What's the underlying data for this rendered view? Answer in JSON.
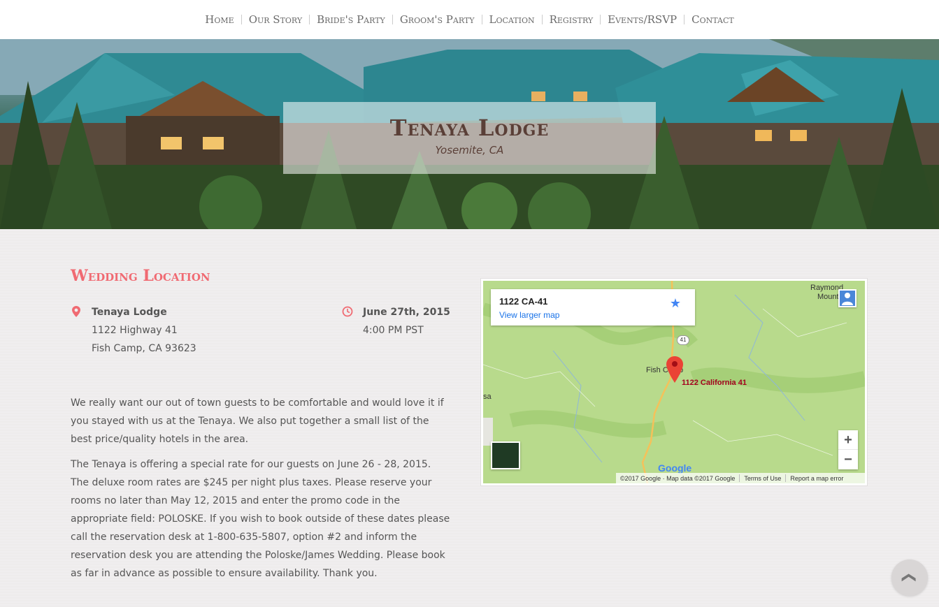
{
  "nav": {
    "items": [
      "Home",
      "Our Story",
      "Bride's Party",
      "Groom's Party",
      "Location",
      "Registry",
      "Events/RSVP",
      "Contact"
    ]
  },
  "hero": {
    "title": "Tenaya Lodge",
    "subtitle": "Yosemite, CA"
  },
  "location": {
    "heading": "Wedding Location",
    "venue_name": "Tenaya Lodge",
    "address_line1": "1122 Highway 41",
    "address_line2": "Fish Camp, CA 93623",
    "date": "June 27th, 2015",
    "time": "4:00 PM PST",
    "paragraph1": "We really want our out of town guests to be comfortable and would love it if you stayed with us at the Tenaya. We also put together a small list of the best price/quality hotels in the area.",
    "paragraph2": "The Tenaya is offering a special rate for our guests on June 26 - 28, 2015. The deluxe room rates are $245 per night plus taxes. Please reserve your rooms no later than May 12, 2015 and enter the promo code in the appropriate field: POLOSKE. If you wish to book outside of these dates please call the reservation desk at 1-800-635-5807, option #2 and inform the reservation desk you are attending the Poloske/James Wedding. Please book as far in advance as possible to ensure availability. Thank you."
  },
  "map": {
    "card_title": "1122 CA-41",
    "card_link": "View larger map",
    "pin_label": "1122 California 41",
    "label_fish_camp": "Fish Camp",
    "label_raymond": "Raymond",
    "label_mountain": "Mounta",
    "label_sa": "sa",
    "road_shield": "41",
    "zoom_in": "+",
    "zoom_out": "−",
    "logo": "Google",
    "footer_copyright": "©2017 Google · Map data ©2017 Google",
    "footer_terms": "Terms of Use",
    "footer_report": "Report a map error"
  },
  "icons": {
    "star": "★",
    "scroll_top": "❮"
  },
  "colors": {
    "accent": "#f06a72",
    "hero_text": "#5a3f37",
    "map_green": "#b7da8a"
  }
}
